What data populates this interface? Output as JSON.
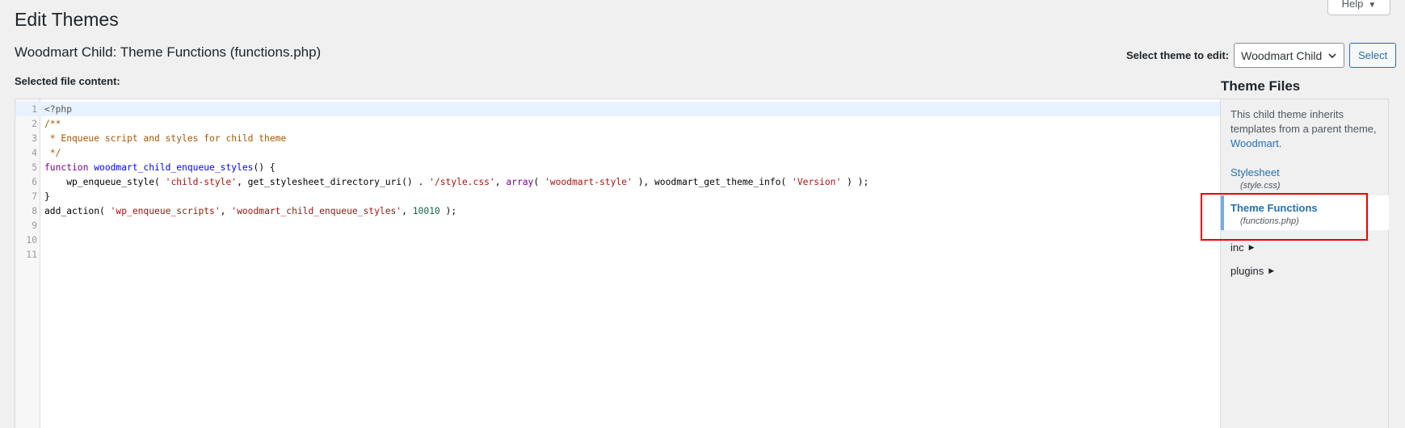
{
  "header": {
    "title": "Edit Themes",
    "help_label": "Help"
  },
  "file_heading": "Woodmart Child: Theme Functions (functions.php)",
  "theme_select": {
    "label": "Select theme to edit:",
    "selected": "Woodmart Child",
    "button": "Select"
  },
  "editor": {
    "label": "Selected file content:",
    "lines": [
      {
        "num": "1",
        "tokens": [
          {
            "t": "meta",
            "v": "<?php"
          }
        ]
      },
      {
        "num": "2",
        "tokens": [
          {
            "t": "comment",
            "v": "/**"
          }
        ]
      },
      {
        "num": "3",
        "tokens": [
          {
            "t": "comment",
            "v": " * Enqueue script and styles for child theme"
          }
        ]
      },
      {
        "num": "4",
        "tokens": [
          {
            "t": "comment",
            "v": " */"
          }
        ]
      },
      {
        "num": "5",
        "tokens": [
          {
            "t": "keyword",
            "v": "function "
          },
          {
            "t": "def",
            "v": "woodmart_child_enqueue_styles"
          },
          {
            "t": "plain",
            "v": "() {"
          }
        ]
      },
      {
        "num": "6",
        "tokens": [
          {
            "t": "plain",
            "v": "    wp_enqueue_style( "
          },
          {
            "t": "string",
            "v": "'child-style'"
          },
          {
            "t": "plain",
            "v": ", get_stylesheet_directory_uri() . "
          },
          {
            "t": "string",
            "v": "'/style.css'"
          },
          {
            "t": "plain",
            "v": ", "
          },
          {
            "t": "keyword",
            "v": "array"
          },
          {
            "t": "plain",
            "v": "( "
          },
          {
            "t": "string",
            "v": "'woodmart-style'"
          },
          {
            "t": "plain",
            "v": " ), woodmart_get_theme_info( "
          },
          {
            "t": "string",
            "v": "'Version'"
          },
          {
            "t": "plain",
            "v": " ) );"
          }
        ]
      },
      {
        "num": "7",
        "tokens": [
          {
            "t": "plain",
            "v": "}"
          }
        ]
      },
      {
        "num": "8",
        "tokens": [
          {
            "t": "plain",
            "v": "add_action( "
          },
          {
            "t": "string",
            "v": "'wp_enqueue_scripts'"
          },
          {
            "t": "plain",
            "v": ", "
          },
          {
            "t": "string",
            "v": "'woodmart_child_enqueue_styles'"
          },
          {
            "t": "plain",
            "v": ", "
          },
          {
            "t": "number",
            "v": "10010"
          },
          {
            "t": "plain",
            "v": " );"
          }
        ]
      },
      {
        "num": "9",
        "tokens": []
      },
      {
        "num": "10",
        "tokens": []
      },
      {
        "num": "11",
        "tokens": []
      }
    ]
  },
  "sidebar": {
    "title": "Theme Files",
    "note_prefix": "This child theme inherits templates from a parent theme, ",
    "note_link": "Woodmart",
    "note_suffix": ".",
    "files": [
      {
        "name": "Stylesheet",
        "path": "(style.css)"
      },
      {
        "name": "Theme Functions",
        "path": "(functions.php)"
      }
    ],
    "folders": [
      "inc",
      "plugins"
    ]
  },
  "colors": {
    "link": "#2271b1",
    "highlight": "#e00000",
    "current_marker": "#72aee6"
  }
}
